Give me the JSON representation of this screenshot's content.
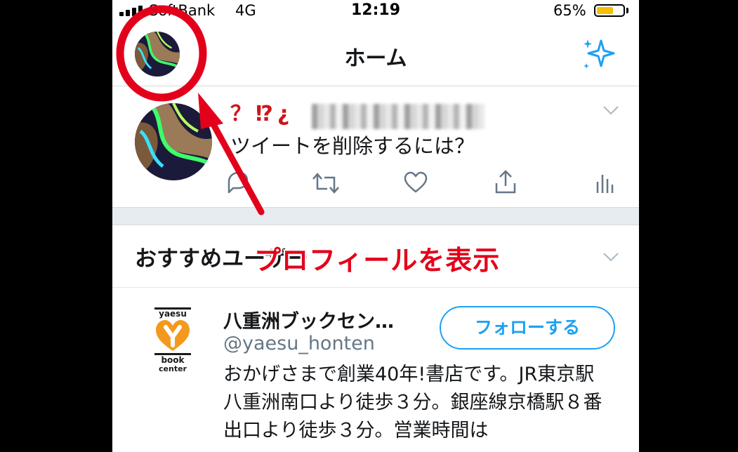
{
  "status_bar": {
    "carrier": "SoftBank",
    "network": "4G",
    "time": "12:19",
    "battery": "65%",
    "battery_level": 0.65
  },
  "nav": {
    "title": "ホーム",
    "sparkle_icon": "sparkle-icon"
  },
  "tweet": {
    "name_marks": "？⁉¿",
    "text": "ツイートを削除するには？",
    "action_icons": [
      "reply-icon",
      "retweet-icon",
      "like-icon",
      "share-icon",
      "analytics-icon"
    ]
  },
  "recommendations": {
    "title": "おすすめユーザー",
    "account": {
      "name": "八重洲ブックセン…",
      "handle": "@yaesu_honten",
      "follow_label": "フォローする",
      "logo_top": "yaesu",
      "logo_bottom": "book\ncenter",
      "bio": "おかげさまで創業40年!書店です。JR東京駅八重洲南口より徒歩３分。銀座線京橋駅８番出口より徒歩３分。営業時間は"
    }
  },
  "annotation": {
    "label": "プロフィールを表示",
    "color": "#e3001b"
  },
  "colors": {
    "accent": "#1da1f2",
    "annotation": "#e3001b",
    "text": "#14171a",
    "secondary_text": "#657786"
  }
}
